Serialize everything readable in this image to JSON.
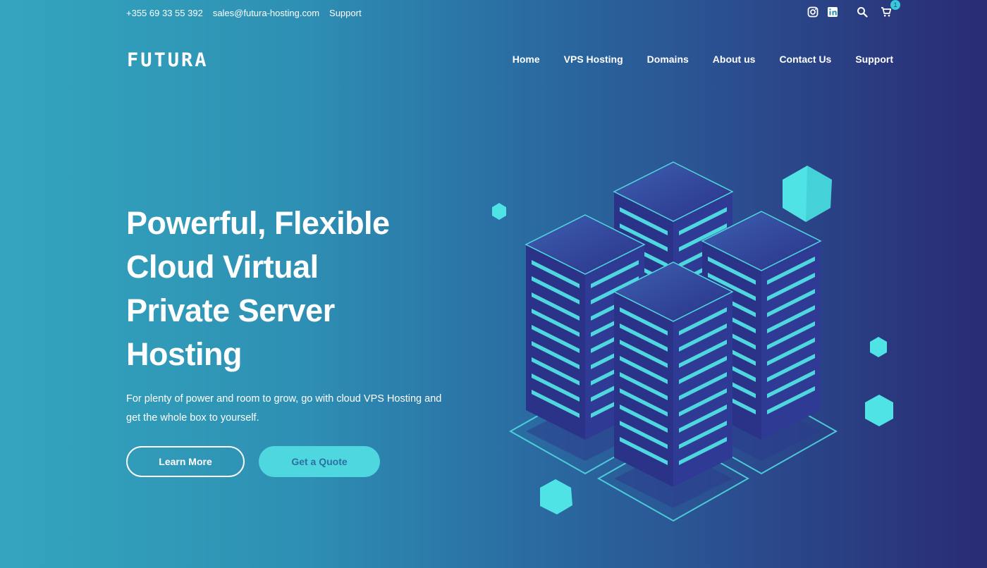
{
  "topbar": {
    "phone": "+355 69 33 55 392",
    "email": "sales@futura-hosting.com",
    "support": "Support",
    "cart_count": "1"
  },
  "brand": {
    "logo": "FUTURA"
  },
  "nav": {
    "items": [
      {
        "label": "Home"
      },
      {
        "label": "VPS Hosting"
      },
      {
        "label": "Domains"
      },
      {
        "label": "About us"
      },
      {
        "label": "Contact Us"
      },
      {
        "label": "Support"
      }
    ]
  },
  "hero": {
    "title_lines": [
      "Powerful, Flexible",
      "Cloud Virtual",
      "Private Server",
      "Hosting"
    ],
    "subtitle": "For plenty of power and room to grow, go with cloud VPS Hosting and get the whole box to yourself.",
    "primary_button": "Learn More",
    "secondary_button": "Get a Quote"
  },
  "colors": {
    "accent": "#4fd7df",
    "bg_left": "#33a6bd",
    "bg_right": "#292b73",
    "server_dark": "#2b3388"
  },
  "icons": [
    "instagram-icon",
    "linkedin-icon",
    "search-icon",
    "cart-icon"
  ]
}
